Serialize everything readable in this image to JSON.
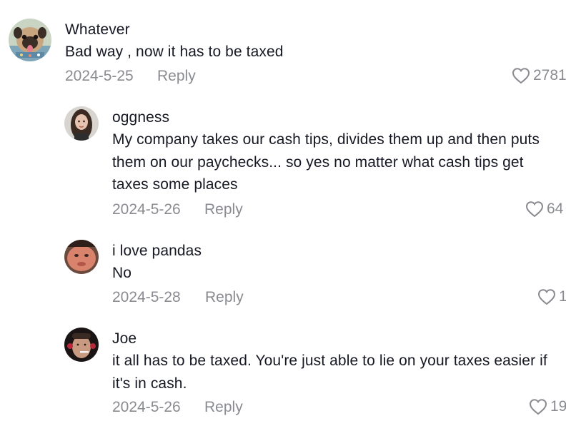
{
  "comments": [
    {
      "username": "Whatever",
      "text": "Bad way , now it has to be taxed",
      "date": "2024-5-25",
      "reply_label": "Reply",
      "likes": "2781",
      "avatar_icon": "pug-avatar"
    },
    {
      "username": "oggness",
      "text_lines": [
        "My company takes our cash tips, divides them up and then puts",
        "them on our paychecks... so yes no matter what cash tips get",
        "taxes some places"
      ],
      "date": "2024-5-26",
      "reply_label": "Reply",
      "likes": "64",
      "avatar_icon": "woman-avatar"
    },
    {
      "username": "i love pandas",
      "text": "No",
      "date": "2024-5-28",
      "reply_label": "Reply",
      "likes": "1",
      "avatar_icon": "face-avatar"
    },
    {
      "username": "Joe",
      "text_lines": [
        "it all has to be taxed. You're just able to lie on your taxes easier if",
        "it's in cash."
      ],
      "date": "2024-5-26",
      "reply_label": "Reply",
      "likes": "19",
      "avatar_icon": "man-avatar"
    }
  ],
  "colors": {
    "text": "#161823",
    "muted": "#8a8b91",
    "background": "#ffffff"
  }
}
